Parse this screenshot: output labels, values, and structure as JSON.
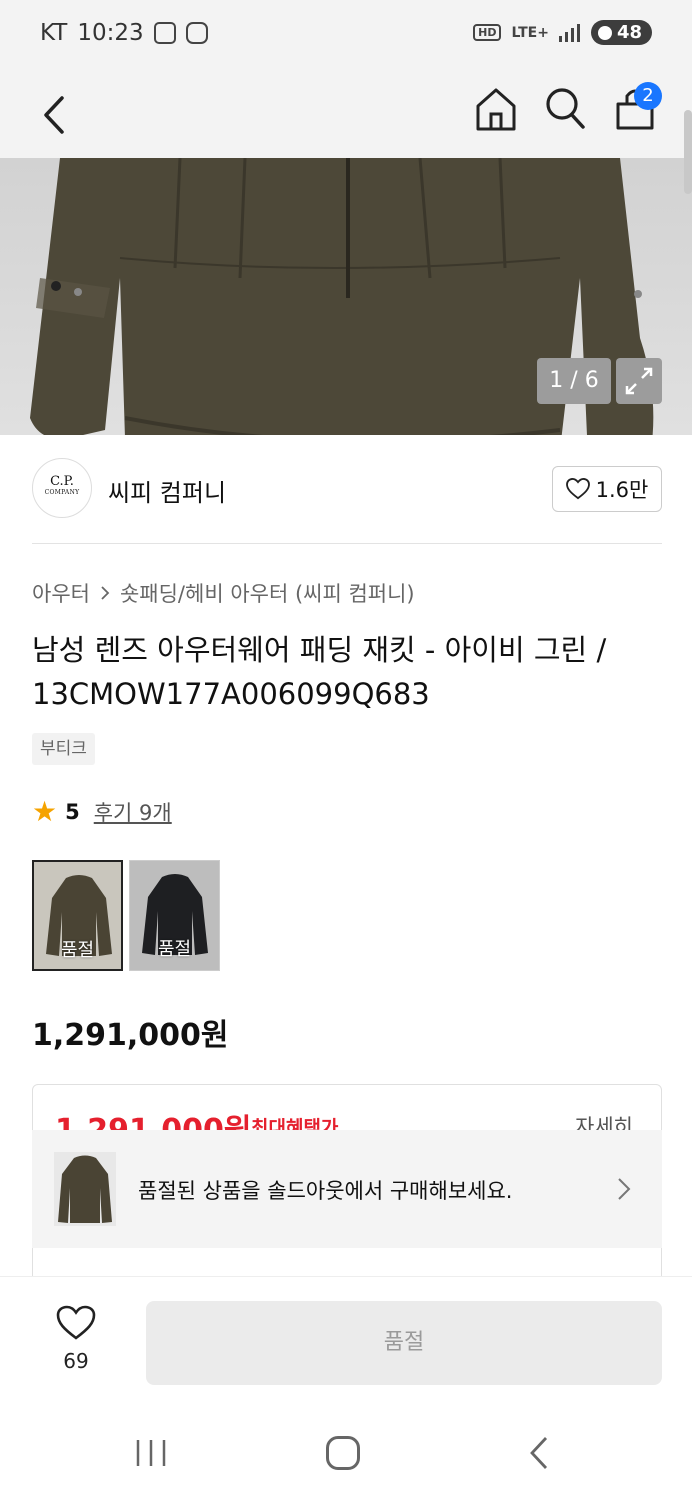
{
  "status_bar": {
    "carrier": "KT",
    "time": "10:23",
    "network_hd": "HD",
    "network_type": "LTE+",
    "battery": "48"
  },
  "nav": {
    "cart_count": "2"
  },
  "gallery": {
    "counter": "1 / 6"
  },
  "brand": {
    "logo_line1": "C.P.",
    "logo_line2": "COMPANY",
    "name": "씨피 컴퍼니",
    "like_count": "1.6만"
  },
  "product": {
    "breadcrumb": [
      "아우터",
      "숏패딩/헤비 아우터 (씨피 컴퍼니)"
    ],
    "title": "남성 렌즈 아우터웨어 패딩 재킷 - 아이비 그린 / 13CMOW177A006099Q683",
    "tag": "부티크",
    "rating": "5",
    "reviews": "후기 9개",
    "swatches": [
      {
        "label": "품절",
        "color": "#4a4434"
      },
      {
        "label": "품절",
        "color": "#1e1f22"
      }
    ],
    "price": "1,291,000원"
  },
  "benefit": {
    "price": "1,291,000원",
    "label": "최대혜택가",
    "detail": "자세히"
  },
  "soldout_banner": {
    "text": "품절된 상품을 솔드아웃에서 구매해보세요."
  },
  "bottom": {
    "wish_count": "69",
    "buy_label": "품절"
  },
  "colors": {
    "accent_blue": "#1976ff",
    "price_red": "#e5202e",
    "star": "#f5a300"
  }
}
